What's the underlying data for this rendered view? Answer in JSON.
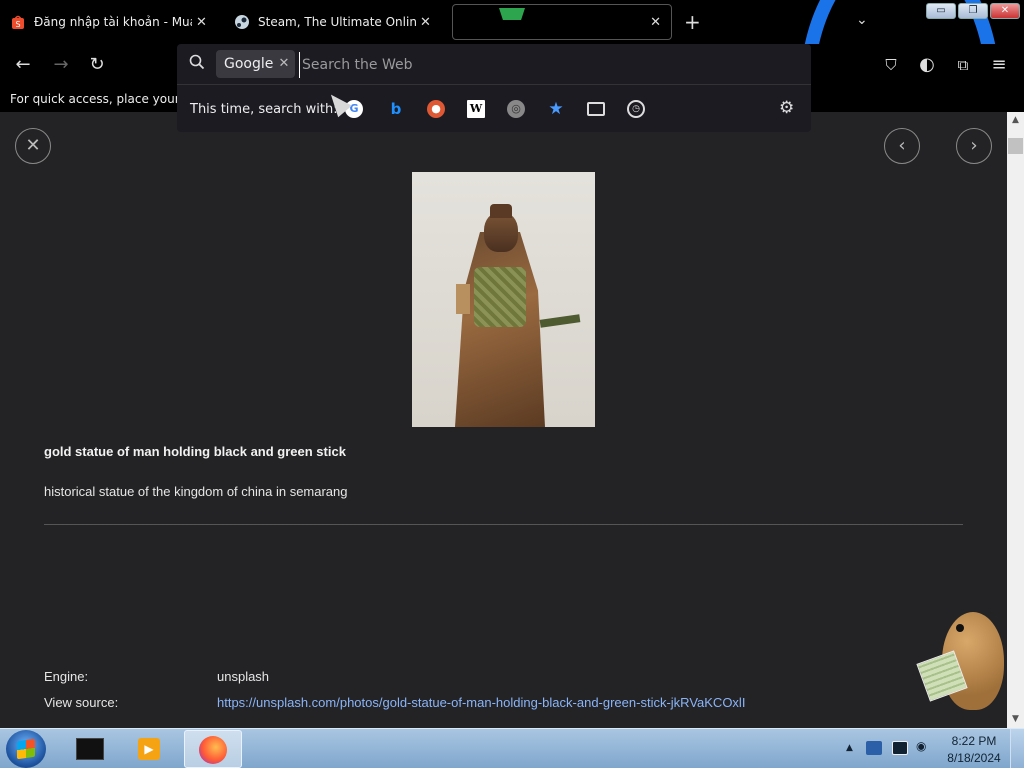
{
  "tabs": [
    {
      "title": "Đăng nhập tài khoản - Mua sắm",
      "close": "✕"
    },
    {
      "title": "Steam, The Ultimate Online Game",
      "close": "✕"
    },
    {
      "title": "",
      "close": "✕"
    }
  ],
  "tabbar": {
    "new_tab": "+",
    "list_tabs": "⌄"
  },
  "window_controls": {
    "minimize": "▭",
    "maximize": "❐",
    "close": "✕"
  },
  "nav": {
    "back": "←",
    "forward": "→",
    "reload": "↻",
    "pocket": "⛉",
    "theme": "◐",
    "extensions": "⧉",
    "menu": "≡"
  },
  "bookmarks_bar": {
    "text": "For quick access, place your bo"
  },
  "search_popup": {
    "engine_chip": "Google",
    "chip_remove": "✕",
    "placeholder": "Search the Web",
    "label": "This time, search with:",
    "engines": {
      "google": "G",
      "bing": "b",
      "ddg": "●",
      "wikipedia": "W",
      "other": "◎",
      "bookmarks": "★",
      "history": "◷"
    },
    "settings": "⚙"
  },
  "viewer": {
    "close": "✕",
    "prev": "‹",
    "next": "›",
    "title": "gold statue of man holding black and green stick",
    "description": "historical statue of the kingdom of china in semarang",
    "engine_label": "Engine:",
    "engine_value": "unsplash",
    "source_label": "View source:",
    "source_url": "https://unsplash.com/photos/gold-statue-of-man-holding-black-and-green-stick-jkRVaKCOxlI"
  },
  "scrollbar": {
    "up": "▲",
    "down": "▼"
  },
  "taskbar": {
    "media_icon": "▶",
    "tray_arrow": "▲",
    "volume": "◉",
    "time": "8:22 PM",
    "date": "8/18/2024"
  },
  "colors": {
    "accent_blue": "#1a73e8",
    "link": "#8ab4f8",
    "page_bg": "#232325"
  }
}
